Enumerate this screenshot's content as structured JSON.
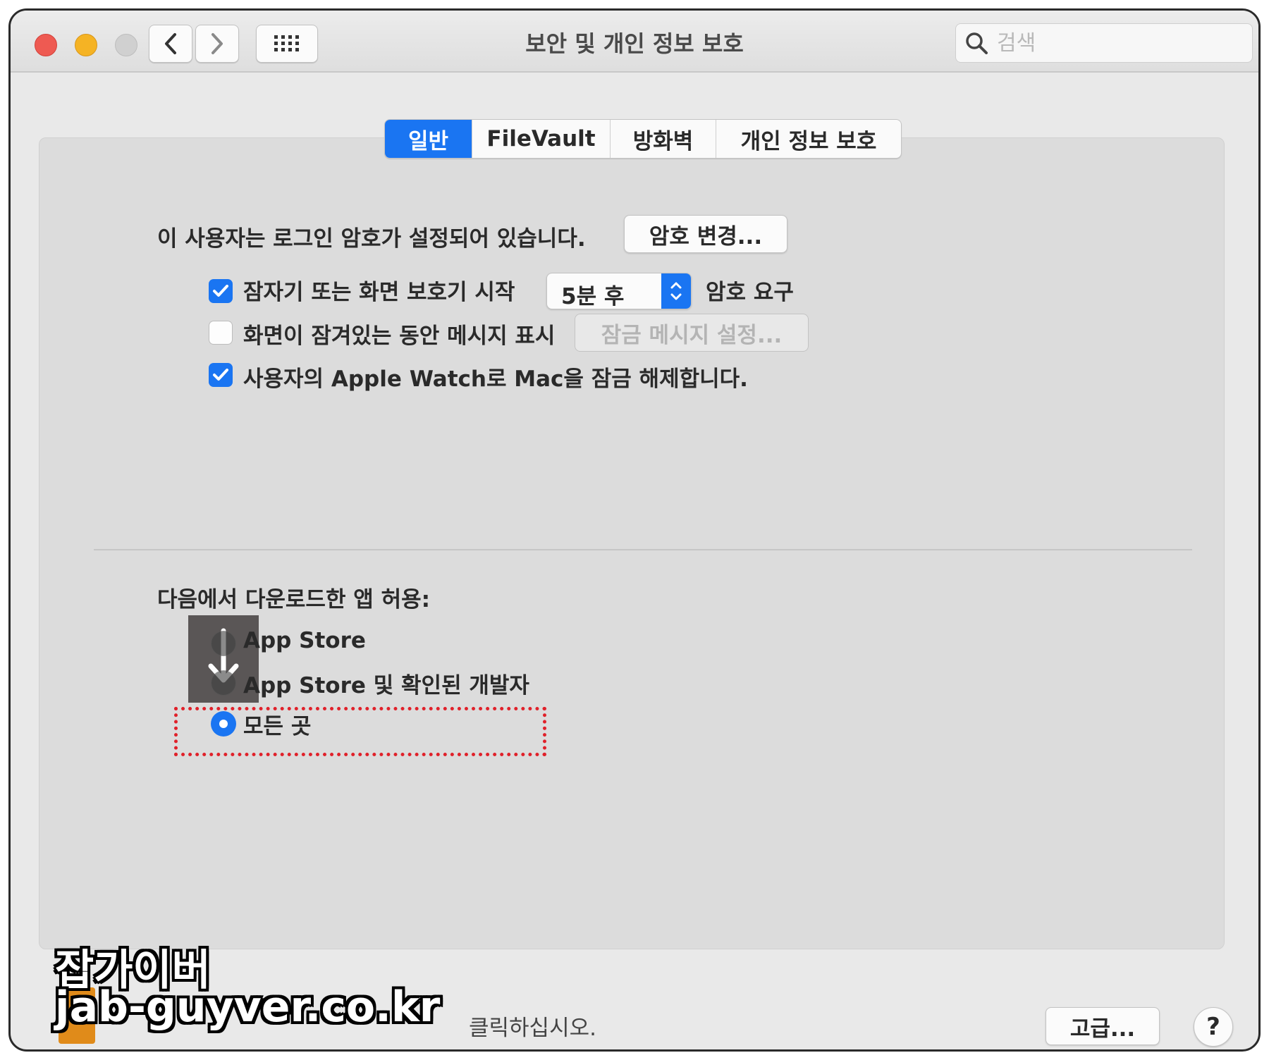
{
  "window": {
    "title": "보안 및 개인 정보 보호",
    "search_placeholder": "검색"
  },
  "tabs": [
    {
      "label": "일반",
      "active": true
    },
    {
      "label": "FileVault",
      "active": false
    },
    {
      "label": "방화벽",
      "active": false
    },
    {
      "label": "개인 정보 보호",
      "active": false
    }
  ],
  "general": {
    "password_text": "이 사용자는 로그인 암호가 설정되어 있습니다.",
    "change_password_button": "암호 변경...",
    "require_password": {
      "checked": true,
      "label": "잠자기 또는 화면 보호기 시작",
      "select_value": "5분 후",
      "suffix": "암호 요구"
    },
    "show_message": {
      "checked": false,
      "label": "화면이 잠겨있는 동안 메시지 표시",
      "button": "잠금 메시지 설정..."
    },
    "apple_watch": {
      "checked": true,
      "label": "사용자의 Apple Watch로 Mac을 잠금 해제합니다."
    }
  },
  "downloads": {
    "heading": "다음에서 다운로드한 앱 허용:",
    "options": [
      {
        "label": "App Store",
        "selected": false
      },
      {
        "label": "App Store 및 확인된 개발자",
        "selected": false
      },
      {
        "label": "모든 곳",
        "selected": true
      }
    ]
  },
  "footer": {
    "lock_text": "클릭하십시오.",
    "advanced_button": "고급...",
    "help_button": "?"
  },
  "watermark": {
    "line1": "잡가이버",
    "line2": "jab-guyver.co.kr"
  },
  "colors": {
    "accent": "#1a75f2",
    "highlight": "#e0212a"
  }
}
